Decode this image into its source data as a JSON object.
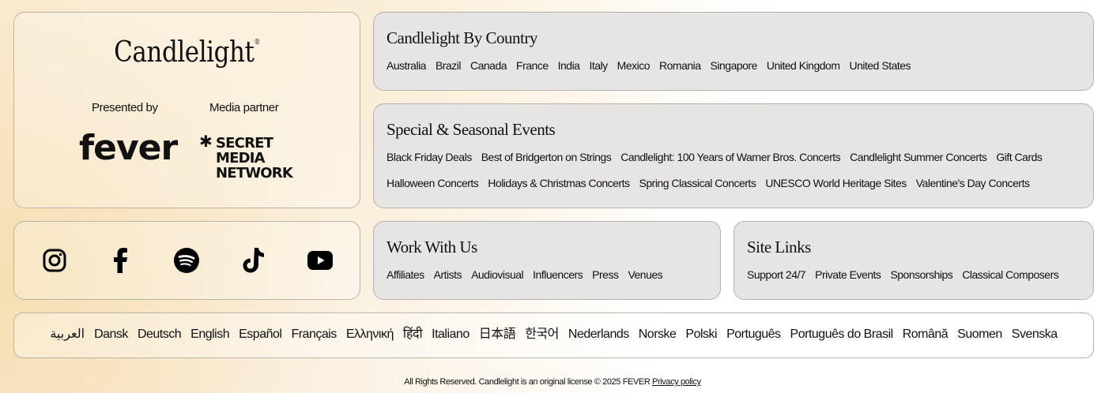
{
  "brand": {
    "logo_text": "Candlelight",
    "logo_mark": "®",
    "presented_by_label": "Presented by",
    "media_partner_label": "Media partner",
    "presenter_logo_text": "fever",
    "partner_logo_lines": [
      "SECRET",
      "MEDIA",
      "NETWORK"
    ],
    "partner_logo_star": "✱"
  },
  "social": {
    "icons": [
      "instagram-icon",
      "facebook-icon",
      "spotify-icon",
      "tiktok-icon",
      "youtube-icon"
    ]
  },
  "country": {
    "title": "Candlelight By Country",
    "links": [
      "Australia",
      "Brazil",
      "Canada",
      "France",
      "India",
      "Italy",
      "Mexico",
      "Romania",
      "Singapore",
      "United Kingdom",
      "United States"
    ]
  },
  "seasonal": {
    "title": "Special & Seasonal Events",
    "links": [
      "Black Friday Deals",
      "Best of Bridgerton on Strings",
      "Candlelight: 100 Years of Warner Bros. Concerts",
      "Candlelight Summer Concerts",
      "Gift Cards",
      "Halloween Concerts",
      "Holidays & Christmas Concerts",
      "Spring Classical Concerts",
      "UNESCO World Heritage Sites",
      "Valentine's Day Concerts"
    ]
  },
  "work": {
    "title": "Work With Us",
    "links": [
      "Affiliates",
      "Artists",
      "Audiovisual",
      "Influencers",
      "Press",
      "Venues"
    ]
  },
  "site_links": {
    "title": "Site Links",
    "links": [
      "Support 24/7",
      "Private Events",
      "Sponsorships",
      "Classical Composers"
    ]
  },
  "languages": [
    "العربية",
    "Dansk",
    "Deutsch",
    "English",
    "Español",
    "Français",
    "Ελληνική",
    "हिंदी",
    "Italiano",
    "日本語",
    "한국어",
    "Nederlands",
    "Norske",
    "Polski",
    "Português",
    "Português do Brasil",
    "Română",
    "Suomen",
    "Svenska"
  ],
  "footer": {
    "text": "All Rights Reserved. Candlelight is an original license © 2025 FEVER",
    "privacy_link": "Privacy policy"
  }
}
